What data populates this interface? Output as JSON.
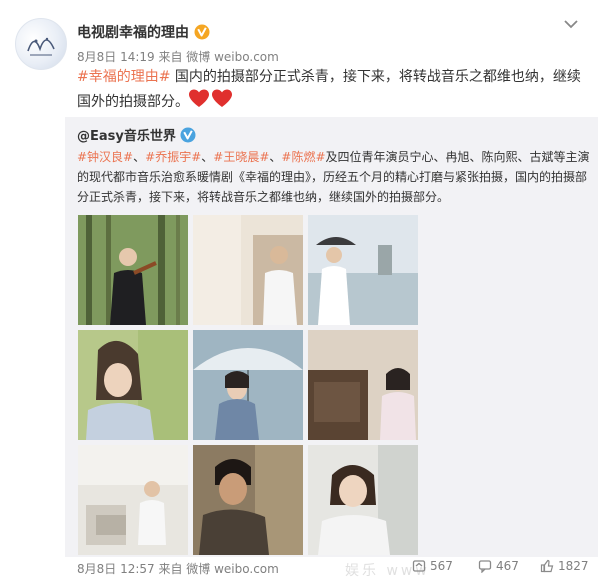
{
  "post": {
    "author": "电视剧幸福的理由",
    "meta": "8月8日 14:19 来自 微博 weibo.com",
    "topic": "#幸福的理由#",
    "body": " 国内的拍摄部分正式杀青，接下来，将转战音乐之都维也纳，继续国外的拍摄部分。"
  },
  "repost": {
    "author": "@Easy音乐世界",
    "tags": [
      "#钟汉良#",
      "#乔振宇#",
      "#王晓晨#",
      "#陈燃#"
    ],
    "sep": "、",
    "body": "及四位青年演员宁心、冉旭、陈向熙、古斌等主演的现代都市音乐治愈系暖情剧《幸福的理由》，历经五个月的精心打磨与紧张拍摄，国内的拍摄部分正式杀青，接下来，将转战音乐之都维也纳，继续国外的拍摄部分。",
    "footer": "8月8日 12:57 来自 微博 weibo.com",
    "reposts": "567",
    "comments": "467",
    "likes": "1827"
  },
  "watermark": "娱乐 www",
  "colors": {
    "topic": "#eb7350",
    "verified": "#f5a623",
    "repost_bg": "#f2f2f5"
  },
  "icons": [
    "verified-icon",
    "chevron-down-icon",
    "heart-icon",
    "repost-icon",
    "comment-icon",
    "like-icon"
  ]
}
